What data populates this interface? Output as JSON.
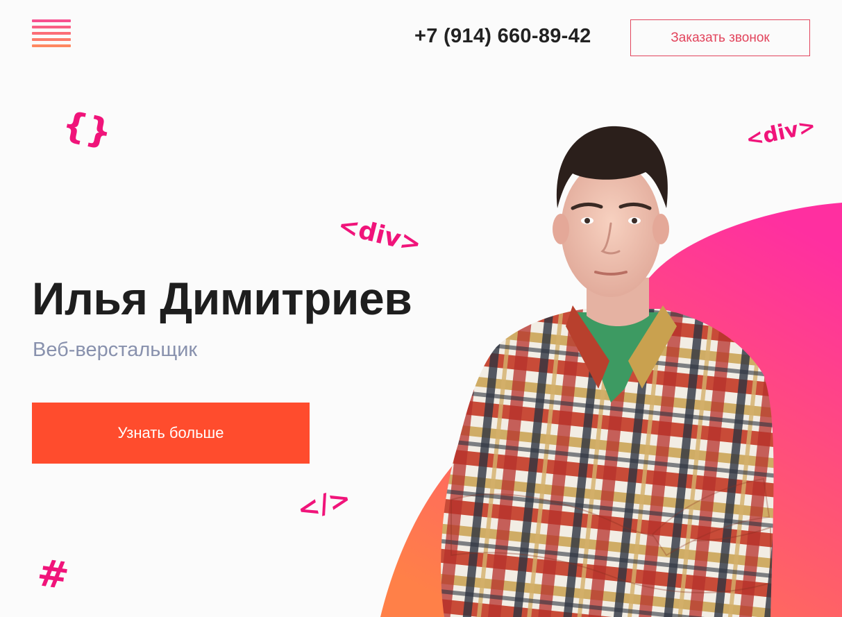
{
  "header": {
    "menu_icon": "hamburger-menu-icon",
    "phone": "+7 (914) 660-89-42",
    "callback_label": "Заказать звонок"
  },
  "hero": {
    "name": "Илья Димитриев",
    "role": "Веб-верстальщик",
    "cta_label": "Узнать больше"
  },
  "decorations": {
    "braces": "{}",
    "div_tag_1": "<div>",
    "div_tag_2": "<div>",
    "close_tag": "</>",
    "hash": "#"
  },
  "colors": {
    "accent_pink": "#f0147a",
    "cta_orange": "#ff4c2d",
    "callback_border": "#e2445c",
    "blob_gradient_top": "#ff2fa0",
    "blob_gradient_bottom": "#ff7a45"
  },
  "images": {
    "portrait": "person-portrait-plaid-shirt"
  }
}
